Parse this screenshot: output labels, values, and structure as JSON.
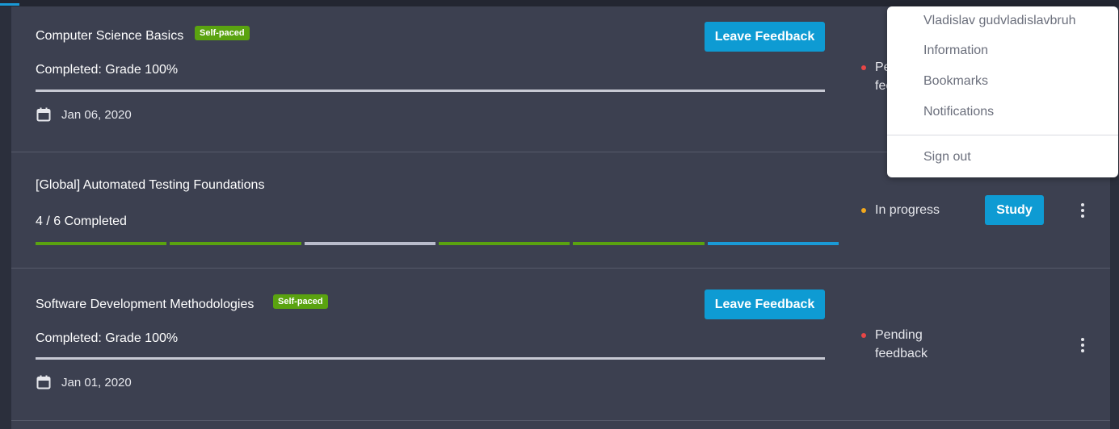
{
  "colors": {
    "accent": "#0e9bd3",
    "self_paced_badge": "#5aa310",
    "status_pending": "#e84646",
    "status_in_progress": "#f2a81d",
    "segment_completed": "#5aa310",
    "segment_pending": "#b9bccb",
    "segment_current": "#1a9ad6"
  },
  "courses": [
    {
      "title": "Computer Science Basics",
      "badge": "Self-paced",
      "progress_text": "Completed: Grade 100%",
      "date": "Jan 06, 2020",
      "action_label": "Leave Feedback",
      "status": "Pe\nfee",
      "date_icon": "calendar-icon"
    },
    {
      "title": "[Global] Automated Testing Foundations",
      "progress_text": "4 / 6 Completed",
      "segments": [
        "completed",
        "completed",
        "pending",
        "completed",
        "completed",
        "current"
      ],
      "status": "In progress",
      "action_label": "Study",
      "menu_icon": "more-vertical-icon"
    },
    {
      "title": "Software Development Methodologies",
      "badge": "Self-paced",
      "progress_text": "Completed: Grade 100%",
      "date": "Jan 01, 2020",
      "action_label": "Leave Feedback",
      "status": "Pending\nfeedback",
      "date_icon": "calendar-icon",
      "menu_icon": "more-vertical-icon"
    }
  ],
  "user_menu": {
    "items": [
      "Vladislav gudvladislavbruh",
      "Information",
      "Bookmarks",
      "Notifications"
    ],
    "sign_out": "Sign out"
  }
}
